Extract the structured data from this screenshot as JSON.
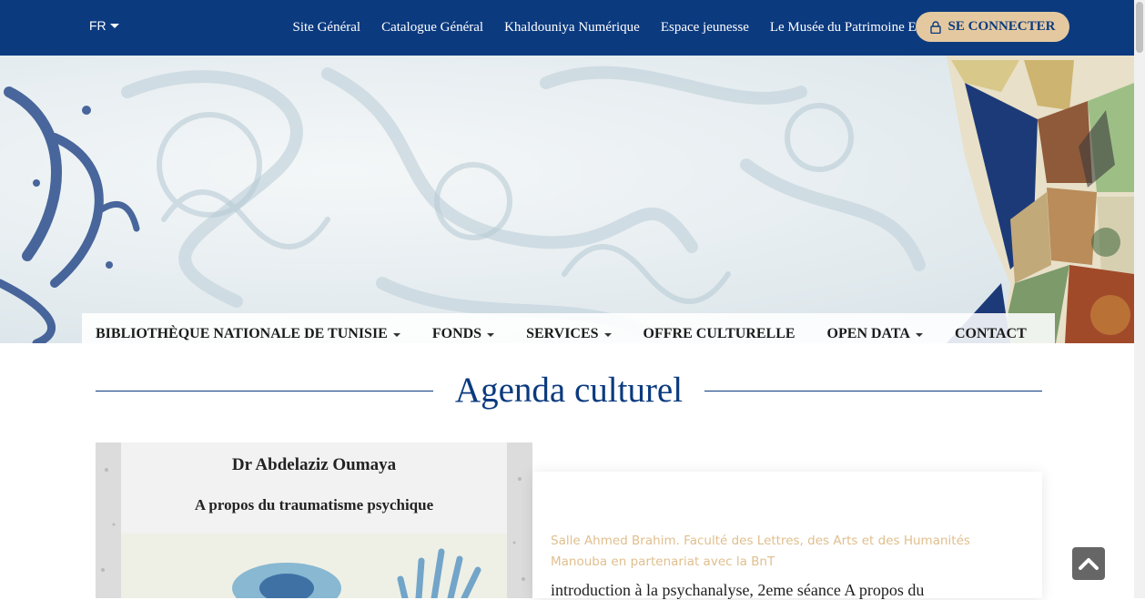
{
  "topbar": {
    "lang": "FR",
    "links": [
      "Site Général",
      "Catalogue Général",
      "Khaldouniya Numérique",
      "Espace jeunesse",
      "Le Musée du Patrimoine Ecrit"
    ],
    "connect_label": "SE CONNECTER"
  },
  "nav": {
    "items": [
      {
        "label": "BIBLIOTHÈQUE NATIONALE DE TUNISIE"
      },
      {
        "label": "FONDS"
      },
      {
        "label": "SERVICES"
      },
      {
        "label": "OFFRE CULTURELLE"
      },
      {
        "label": "OPEN DATA"
      },
      {
        "label": "CONTACT"
      }
    ]
  },
  "section": {
    "title": "Agenda culturel"
  },
  "event": {
    "poster_author": "Dr Abdelaziz Oumaya",
    "poster_title": "A propos du traumatisme psychique",
    "location": "Salle Ahmed Brahim. Faculté des Lettres, des Arts et des Humanités Manouba en partenariat avec la BnT",
    "description": "introduction à la psychanalyse, 2eme séance A propos du"
  },
  "colors": {
    "primary": "#0b3a7f",
    "accent": "#e4c9a0",
    "location_text": "#e0bf8e"
  },
  "icons": {
    "lock": "lock-icon",
    "scroll_top": "chevron-up-icon",
    "lang_caret": "caret-down-icon"
  }
}
